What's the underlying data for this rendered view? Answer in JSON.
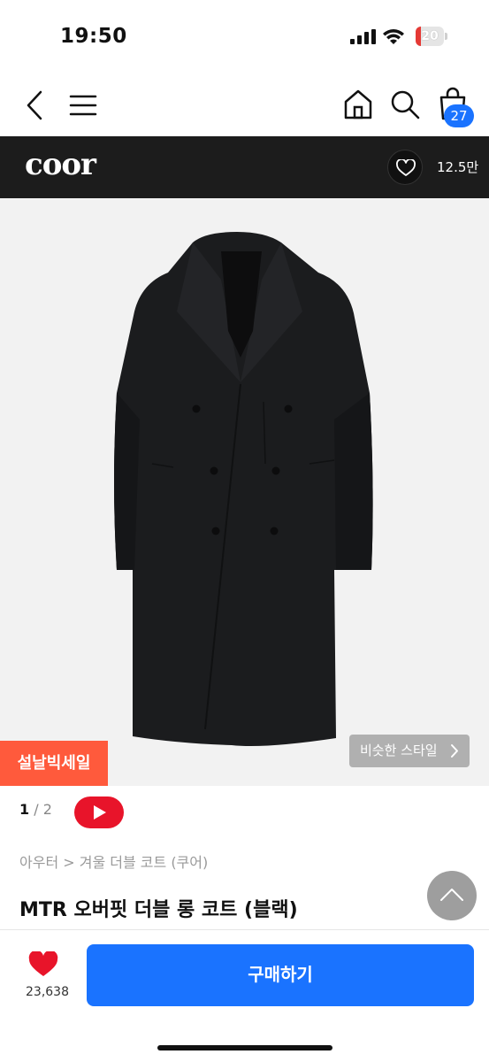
{
  "status_bar": {
    "time": "19:50",
    "battery": "20"
  },
  "nav": {
    "icons": [
      "back-icon",
      "menu-icon",
      "home-icon",
      "search-icon",
      "shopping-bag-icon"
    ],
    "cart_count": "27"
  },
  "brand": {
    "name": "coor",
    "likes": "12.5만"
  },
  "product": {
    "image_index": "1",
    "image_total": "2",
    "sale_tag": "설날빅세일",
    "similar_style": "비슷한 스타일",
    "breadcrumb": "아우터 > 겨울 더블 코트 (쿠어)",
    "title": "MTR 오버핏 더블 롱 코트 (블랙)"
  },
  "bottom": {
    "like_count": "23,638",
    "buy_label": "구매하기"
  },
  "colors": {
    "accent": "#1a73ff",
    "sale": "#ff5a3c",
    "youtube": "#e8142a",
    "heart": "#e8142a"
  }
}
